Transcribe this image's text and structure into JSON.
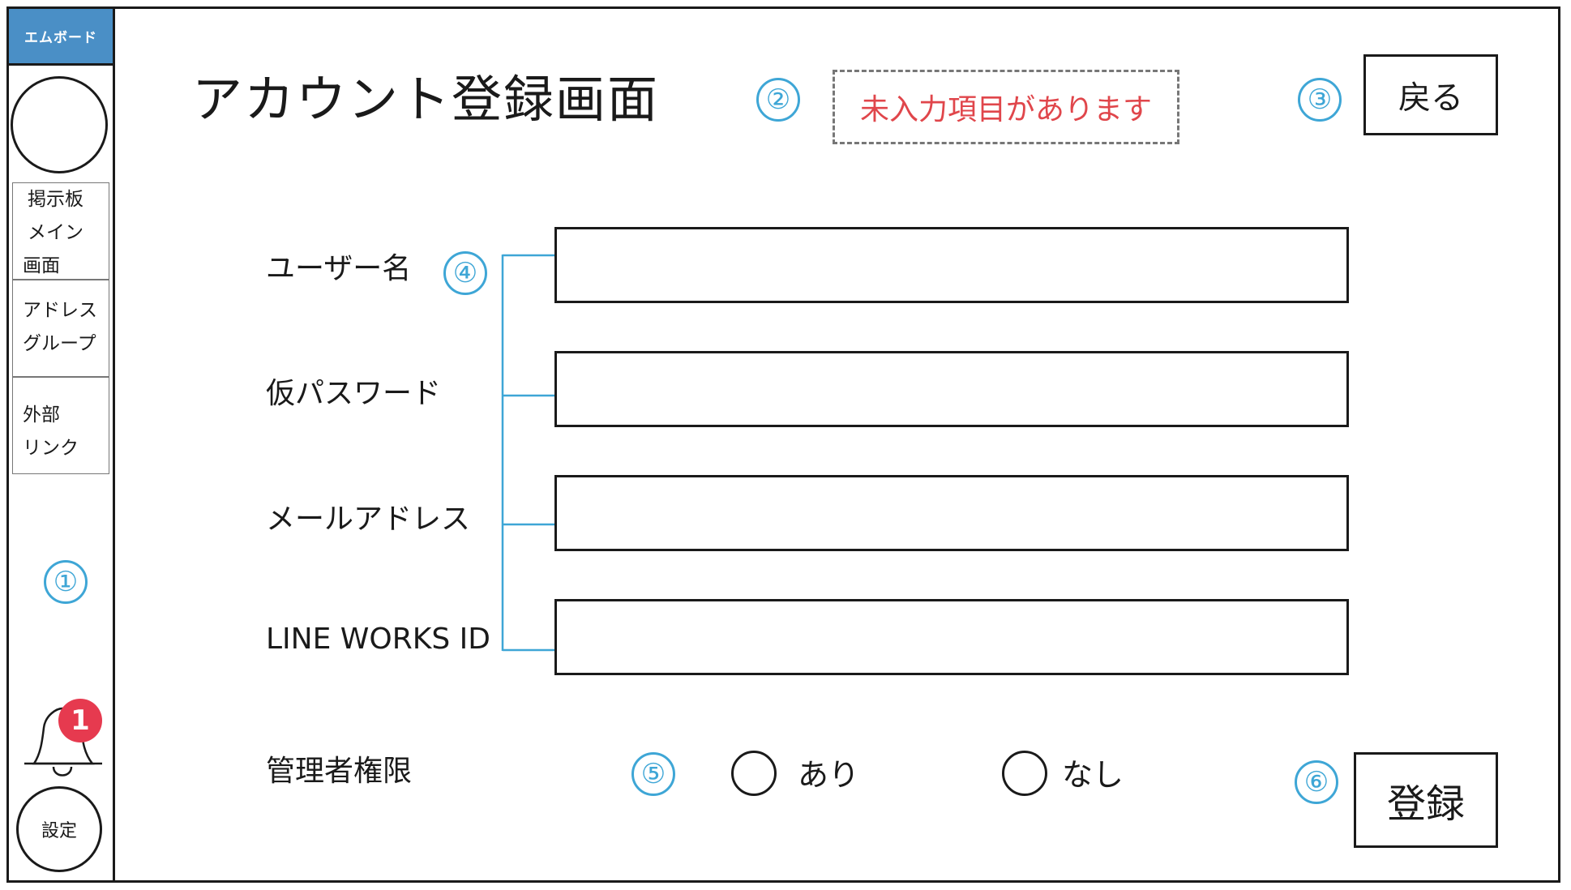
{
  "sidebar": {
    "brand": "エムボード",
    "nav_items": [
      {
        "lines": [
          "掲示板",
          "メイン",
          "画面"
        ]
      },
      {
        "lines": [
          "アドレス",
          "グループ"
        ]
      },
      {
        "lines": [
          "外部",
          "リンク"
        ]
      }
    ],
    "notification_count": "1",
    "settings_label": "設定"
  },
  "markers": [
    "①",
    "②",
    "③",
    "④",
    "⑤",
    "⑥"
  ],
  "header": {
    "title": "アカウント登録画面",
    "error_message": "未入力項目があります",
    "back_label": "戻る"
  },
  "form": {
    "fields": [
      {
        "label": "ユーザー名",
        "value": ""
      },
      {
        "label": "仮パスワード",
        "value": ""
      },
      {
        "label": "メールアドレス",
        "value": ""
      },
      {
        "label": "LINE WORKS ID",
        "value": ""
      }
    ],
    "admin": {
      "label": "管理者権限",
      "options": [
        "あり",
        "なし"
      ]
    },
    "submit_label": "登録"
  },
  "colors": {
    "brand": "#4a8fc6",
    "marker": "#3ea6d6",
    "error": "#e0464b",
    "badge": "#e63a4f"
  }
}
